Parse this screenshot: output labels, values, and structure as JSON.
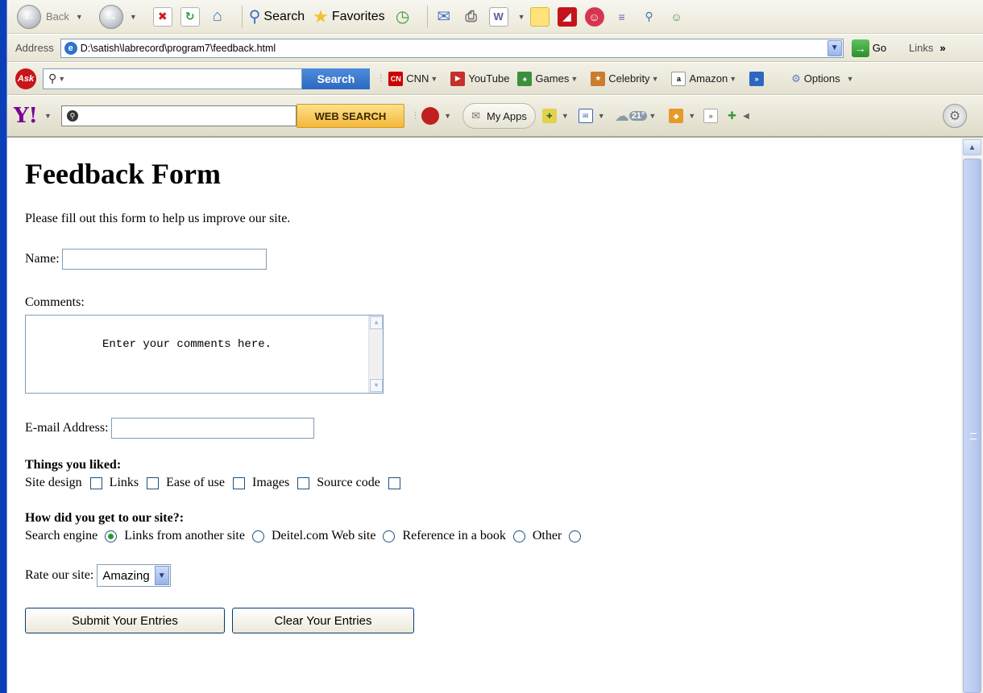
{
  "toolbar": {
    "back_label": "Back",
    "search_label": "Search",
    "favorites_label": "Favorites"
  },
  "address_bar": {
    "label": "Address",
    "url": "D:\\satish\\labrecord\\program7\\feedback.html",
    "go_label": "Go",
    "links_label": "Links",
    "more_glyph": "»"
  },
  "ask_toolbar": {
    "logo_text": "Ask",
    "search_button": "Search",
    "links": [
      {
        "label": "CNN",
        "icon": "cnn-icon",
        "dropdown": true
      },
      {
        "label": "YouTube",
        "icon": "youtube-icon",
        "dropdown": false
      },
      {
        "label": "Games",
        "icon": "games-icon",
        "dropdown": true
      },
      {
        "label": "Celebrity",
        "icon": "celebrity-icon",
        "dropdown": true
      },
      {
        "label": "Amazon",
        "icon": "amazon-icon",
        "dropdown": true
      }
    ],
    "options_label": "Options"
  },
  "yahoo_toolbar": {
    "logo_text": "Y!",
    "web_search_button": "WEB SEARCH",
    "my_apps_label": "My Apps",
    "weather_value": "21°"
  },
  "page": {
    "title": "Feedback Form",
    "intro": "Please fill out this form to help us improve our site.",
    "name_label": "Name:",
    "comments_label": "Comments:",
    "comments_value": "Enter your comments here.",
    "email_label": "E-mail Address:",
    "liked_heading": "Things you liked:",
    "liked_options": [
      "Site design",
      "Links",
      "Ease of use",
      "Images",
      "Source code"
    ],
    "how_heading": "How did you get to our site?:",
    "how_options": [
      "Search engine",
      "Links from another site",
      "Deitel.com Web site",
      "Reference in a book",
      "Other"
    ],
    "how_selected_index": 0,
    "rate_label": "Rate our site:",
    "rate_value": "Amazing",
    "submit_label": "Submit Your Entries",
    "clear_label": "Clear Your Entries"
  },
  "colors": {
    "accent_blue": "#2c68c0",
    "web_search_yellow": "#f4b73a",
    "ask_red": "#c8141b",
    "yahoo_purple": "#7b0099"
  }
}
